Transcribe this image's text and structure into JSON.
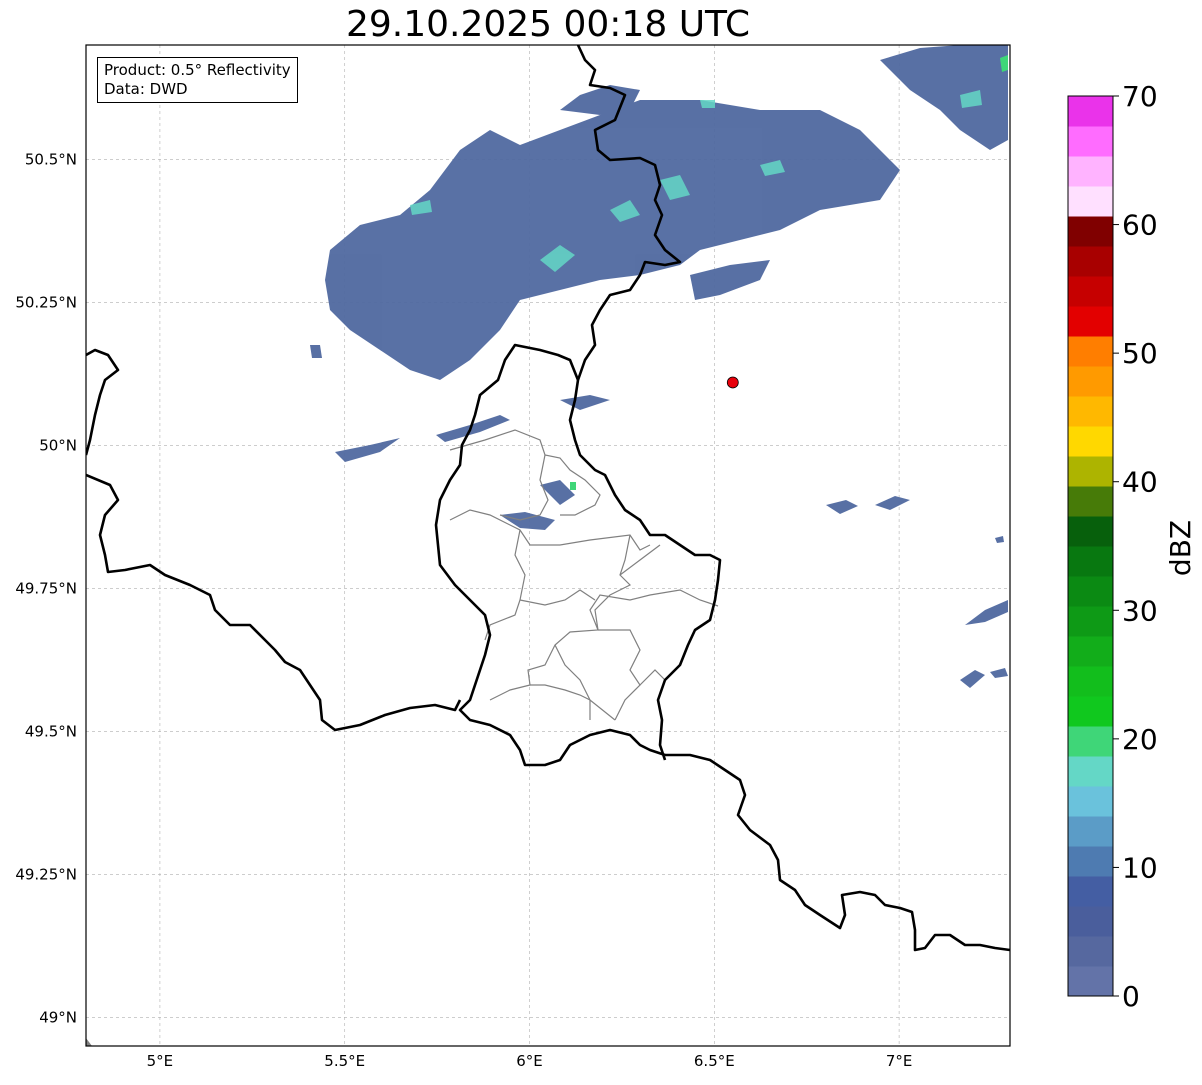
{
  "title": "29.10.2025 00:18 UTC",
  "info_box": {
    "product": "Product: 0.5° Reflectivity",
    "source": "Data: DWD"
  },
  "map": {
    "lon_range": [
      4.8,
      7.3
    ],
    "lat_range": [
      48.95,
      50.7
    ],
    "lon_ticks": [
      {
        "value": 5.0,
        "label": "5°E"
      },
      {
        "value": 5.5,
        "label": "5.5°E"
      },
      {
        "value": 6.0,
        "label": "6°E"
      },
      {
        "value": 6.5,
        "label": "6.5°E"
      },
      {
        "value": 7.0,
        "label": "7°E"
      }
    ],
    "lat_ticks": [
      {
        "value": 50.5,
        "label": "50.5°N"
      },
      {
        "value": 50.25,
        "label": "50.25°N"
      },
      {
        "value": 50.0,
        "label": "50°N"
      },
      {
        "value": 49.75,
        "label": "49.75°N"
      },
      {
        "value": 49.5,
        "label": "49.5°N"
      },
      {
        "value": 49.25,
        "label": "49.25°N"
      },
      {
        "value": 49.0,
        "label": "49°N"
      }
    ],
    "grid": true,
    "marker": {
      "lon": 6.55,
      "lat": 50.11,
      "color": "#e8000b"
    }
  },
  "colorbar": {
    "label": "dBZ",
    "min": 0,
    "max": 70,
    "ticks": [
      {
        "value": 0,
        "label": "0"
      },
      {
        "value": 10,
        "label": "10"
      },
      {
        "value": 20,
        "label": "20"
      },
      {
        "value": 30,
        "label": "30"
      },
      {
        "value": 40,
        "label": "40"
      },
      {
        "value": 50,
        "label": "50"
      },
      {
        "value": 60,
        "label": "60"
      },
      {
        "value": 70,
        "label": "70"
      }
    ],
    "colors": [
      "#6373a8",
      "#56689f",
      "#4a5e9c",
      "#445ea3",
      "#4e7bb1",
      "#5b9cc7",
      "#6ac2dc",
      "#64d7c6",
      "#3fd678",
      "#10c81e",
      "#12be1c",
      "#12ad1a",
      "#0e9a16",
      "#0b8a13",
      "#087810",
      "#07600c",
      "#477b08",
      "#adb400",
      "#ffd800",
      "#ffb800",
      "#ff9a00",
      "#ff7e00",
      "#e30000",
      "#c60000",
      "#a80000",
      "#800000",
      "#ffe0ff",
      "#ffb3ff",
      "#ff6cff",
      "#ea33ea"
    ]
  }
}
